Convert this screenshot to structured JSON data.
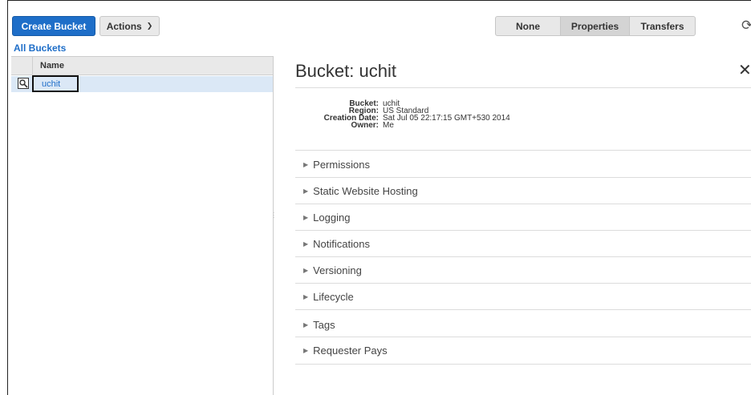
{
  "toolbar": {
    "create_bucket": "Create Bucket",
    "actions": "Actions",
    "view_modes": [
      "None",
      "Properties",
      "Transfers"
    ],
    "selected_view": "Properties"
  },
  "nav": {
    "all_buckets": "All Buckets"
  },
  "bucket_list": {
    "column_name": "Name",
    "rows": [
      {
        "name": "uchit",
        "selected": true
      }
    ]
  },
  "details": {
    "title": "Bucket: uchit",
    "properties": [
      {
        "key": "Bucket:",
        "value": "uchit"
      },
      {
        "key": "Region:",
        "value": "US Standard"
      },
      {
        "key": "Creation Date:",
        "value": "Sat Jul 05 22:17:15 GMT+530 2014"
      },
      {
        "key": "Owner:",
        "value": "Me"
      }
    ],
    "sections": [
      "Permissions",
      "Static Website Hosting",
      "Logging",
      "Notifications",
      "Versioning",
      "Lifecycle",
      "Tags",
      "Requester Pays"
    ]
  },
  "colors": {
    "primary": "#1e6ec8",
    "selected_row": "#dbe8f6"
  }
}
